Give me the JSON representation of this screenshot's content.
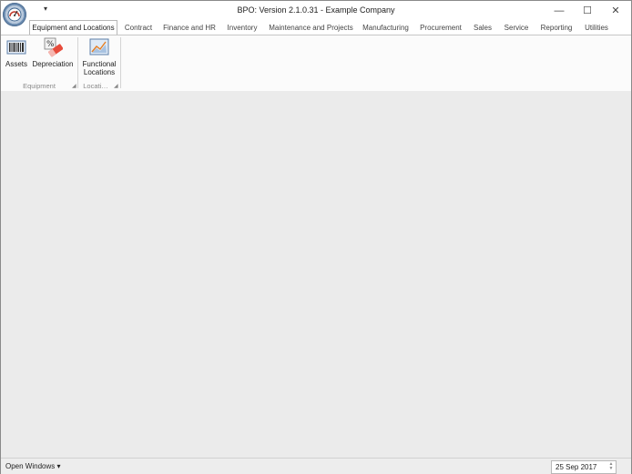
{
  "window": {
    "title": "BPO: Version 2.1.0.31 - Example Company",
    "qat_dropdown": "▾",
    "minimize": "—",
    "maximize": "☐",
    "close": "✕"
  },
  "tabs": [
    {
      "label": "Equipment and Locations",
      "active": true
    },
    {
      "label": "Contract"
    },
    {
      "label": "Finance and HR"
    },
    {
      "label": "Inventory"
    },
    {
      "label": "Maintenance and Projects"
    },
    {
      "label": "Manufacturing"
    },
    {
      "label": "Procurement"
    },
    {
      "label": "Sales"
    },
    {
      "label": "Service"
    },
    {
      "label": "Reporting"
    },
    {
      "label": "Utilities"
    }
  ],
  "ribbon": {
    "groups": [
      {
        "label": "Equipment",
        "buttons": [
          {
            "label": "Assets",
            "icon": "barcode-icon"
          },
          {
            "label": "Depreciation",
            "icon": "depreciation-icon"
          }
        ]
      },
      {
        "label": "Locati…",
        "buttons": [
          {
            "label": "Functional Locations",
            "icon": "chart-picture-icon"
          }
        ]
      }
    ],
    "launcher": "◢"
  },
  "statusbar": {
    "open_windows": "Open Windows ▾",
    "date": "25 Sep 2017",
    "spin_up": "▲",
    "spin_down": "▼"
  },
  "colors": {
    "workspace": "#ebebeb",
    "accent_blue": "#4a7bb7",
    "ribbon_bg": "#fbfbfb"
  }
}
